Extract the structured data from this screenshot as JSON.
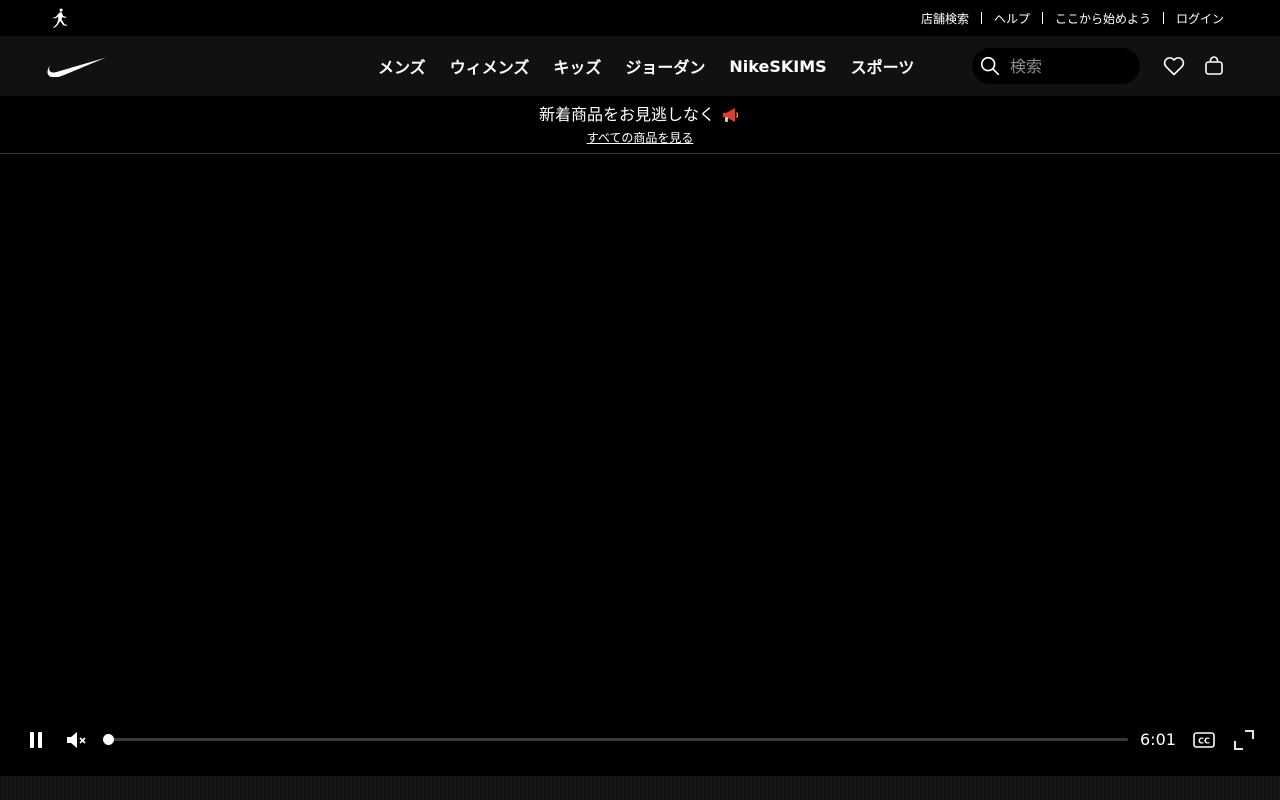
{
  "topbar": {
    "links": [
      "店舗検索",
      "ヘルプ",
      "ここから始めよう",
      "ログイン"
    ]
  },
  "nav": {
    "items": [
      "メンズ",
      "ウィメンズ",
      "キッズ",
      "ジョーダン",
      "NikeSKIMS",
      "スポーツ"
    ],
    "search": {
      "placeholder": "検索"
    }
  },
  "promo": {
    "title": "新着商品をお見逃しなく",
    "link": "すべての商品を見る"
  },
  "video": {
    "time": "6:01",
    "progress": 0.0
  },
  "colors": {
    "background": "#000000",
    "nav_background": "#111111",
    "text": "#ffffff"
  }
}
